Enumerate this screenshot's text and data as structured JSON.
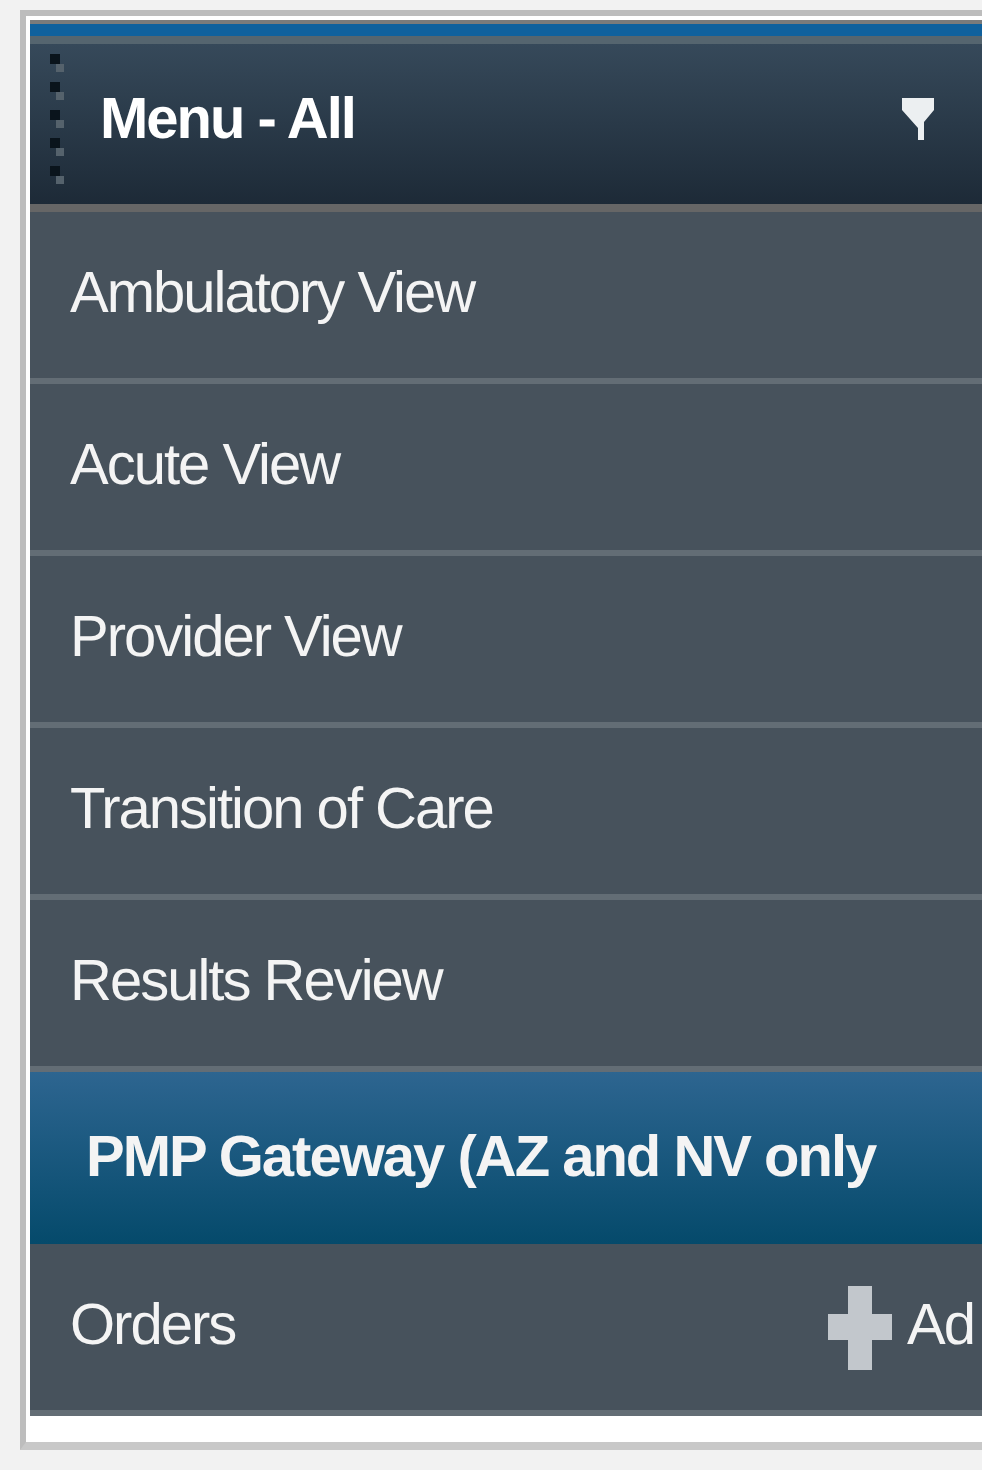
{
  "menu": {
    "title": "Menu - All",
    "items": [
      {
        "label": "Ambulatory View",
        "selected": false
      },
      {
        "label": "Acute View",
        "selected": false
      },
      {
        "label": "Provider View",
        "selected": false
      },
      {
        "label": "Transition of Care",
        "selected": false
      },
      {
        "label": "Results Review",
        "selected": false
      },
      {
        "label": "PMP Gateway (AZ and NV only",
        "selected": true
      },
      {
        "label": "Orders",
        "selected": false,
        "action": "Ad"
      }
    ]
  }
}
